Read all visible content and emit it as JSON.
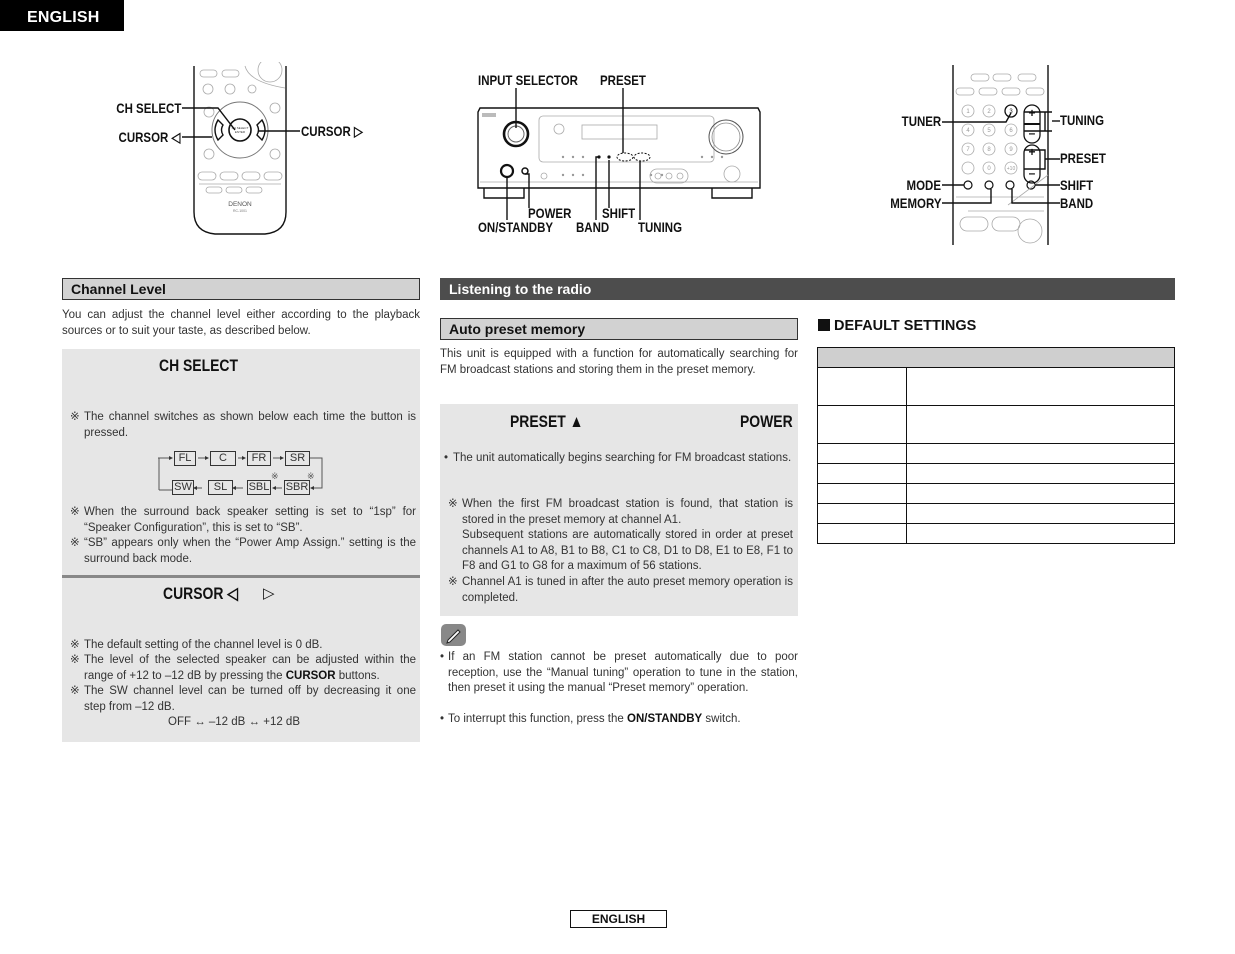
{
  "page": {
    "language_tab": "ENGLISH",
    "footer_language": "ENGLISH"
  },
  "figures": {
    "remote_left": {
      "brand": "DENON",
      "model": "RC-1001",
      "labels": {
        "ch_select": "CH SELECT",
        "cursor_left": "CURSOR ◁",
        "cursor_right": "CURSOR ▷"
      }
    },
    "receiver": {
      "labels": {
        "input_selector": "INPUT SELECTOR",
        "preset": "PRESET",
        "power": "POWER",
        "on_standby": "ON/STANDBY",
        "band": "BAND",
        "shift": "SHIFT",
        "tuning": "TUNING"
      }
    },
    "remote_right": {
      "labels": {
        "tuner": "TUNER",
        "tuning": "TUNING",
        "preset": "PRESET",
        "mode": "MODE",
        "memory": "MEMORY",
        "shift": "SHIFT",
        "band": "BAND"
      },
      "keypad": [
        "1",
        "2",
        "3",
        "4",
        "5",
        "6",
        "7",
        "8",
        "9",
        "",
        "0",
        "+10"
      ]
    }
  },
  "channel_level": {
    "heading": "Channel Level",
    "intro": "You can adjust the channel level either according to the playback sources or to suit your taste, as described below.",
    "step1": {
      "button": "CH SELECT",
      "note": "The channel switches as shown below each time the button is pressed.",
      "cycle_top": [
        "FL",
        "C",
        "FR",
        "SR"
      ],
      "cycle_bottom": [
        "SW",
        "SL",
        "SBL",
        "SBR"
      ],
      "footnotes": [
        "When the surround back speaker setting is set to “1sp” for “Speaker Configuration”, this is set to “SB”.",
        "“SB” appears only when the “Power Amp Assign.” setting is the surround back mode."
      ]
    },
    "step2": {
      "button": "CURSOR ◁",
      "button_right": "▷",
      "notes": [
        "The default setting of the channel level is 0 dB.",
        "The level of the selected speaker can be adjusted within the range of +12 to –12 dB by pressing the",
        "The SW channel level can be turned off by decreasing it one step from –12 dB."
      ],
      "bold_word": "CURSOR",
      "after_bold": " buttons.",
      "range": "OFF ↔ –12 dB ↔ +12 dB"
    },
    "note_mark": "※"
  },
  "radio": {
    "heading": "Listening to the radio",
    "auto_preset": {
      "heading": "Auto preset memory",
      "intro": "This unit is equipped with a function for automatically searching for FM broadcast stations and storing them in the preset memory.",
      "step_left": "PRESET ▲",
      "step_right": "POWER",
      "bullet": "The unit automatically begins searching for FM broadcast stations.",
      "notes": [
        "When the first FM broadcast station is found, that station is stored in the preset memory at channel A1.",
        "Subsequent stations are automatically stored in order at preset channels A1 to A8, B1 to B8, C1 to C8, D1 to D8, E1 to E8, F1 to F8 and G1 to G8 for a maximum of 56 stations.",
        "Channel A1 is tuned in after the auto preset memory operation is completed."
      ],
      "tips": [
        "If an FM station cannot be preset automatically due to poor reception, use the “Manual tuning” operation to tune in the station, then preset it using the manual “Preset memory” operation.",
        "To interrupt this function, press the"
      ],
      "tip_bold": "ON/STANDBY",
      "tip_after": " switch.",
      "bullet_mark": "•",
      "note_mark": "※"
    }
  },
  "default_settings": {
    "title": "DEFAULT SETTINGS",
    "rows": 7
  }
}
